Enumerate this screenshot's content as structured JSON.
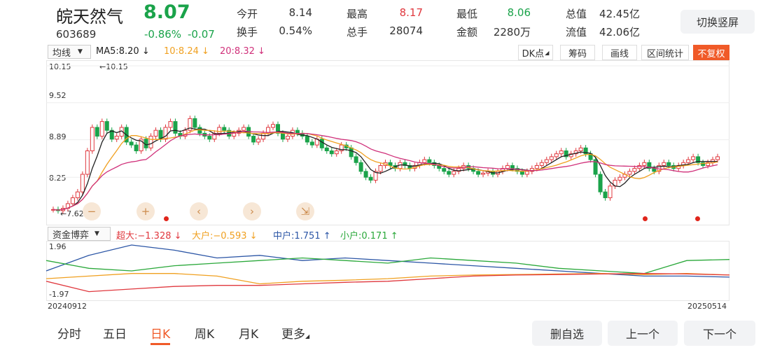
{
  "header": {
    "name": "皖天然气",
    "price": "8.07",
    "code": "603689",
    "change_pct": "-0.86%",
    "change_amt": "-0.07",
    "quotes": [
      {
        "label": "今开",
        "value": "8.14",
        "color": "#333333"
      },
      {
        "label": "最高",
        "value": "8.17",
        "color": "#e0383e"
      },
      {
        "label": "最低",
        "value": "8.06",
        "color": "#1aa34a"
      },
      {
        "label": "总值",
        "value": "42.45亿",
        "color": "#333333"
      },
      {
        "label": "换手",
        "value": "0.54%",
        "color": "#333333"
      },
      {
        "label": "总手",
        "value": "28074",
        "color": "#333333"
      },
      {
        "label": "金额",
        "value": "2280万",
        "color": "#333333"
      },
      {
        "label": "流值",
        "value": "42.06亿",
        "color": "#333333"
      }
    ],
    "orientation_button": "切换竖屏"
  },
  "toolbar": {
    "ma_select": "均线",
    "ma5": "MA5:8.20",
    "ma10": "10:8.24",
    "ma20": "20:8.32",
    "ma5_color": "#222222",
    "ma10_color": "#f0a020",
    "ma20_color": "#d0307a",
    "dk_button": "DK点",
    "chips_button": "筹码",
    "draw_button": "画线",
    "range_button": "区间统计",
    "adjust_button": "不复权"
  },
  "chart": {
    "y_labels": [
      "10.15",
      "9.52",
      "8.89",
      "8.25",
      "7.62"
    ],
    "max_label": "←10.15",
    "min_label": "←7.62",
    "start_date": "20240912",
    "end_date": "20250514"
  },
  "chart_data": {
    "type": "candlestick",
    "ylim": [
      7.62,
      10.15
    ],
    "close": [
      7.7,
      7.68,
      7.72,
      7.8,
      7.9,
      8.0,
      8.3,
      8.7,
      9.1,
      8.95,
      9.2,
      9.05,
      8.9,
      8.95,
      9.1,
      8.85,
      8.8,
      8.7,
      8.9,
      8.75,
      8.95,
      9.05,
      8.9,
      9.1,
      9.2,
      9.0,
      8.95,
      9.05,
      9.25,
      9.1,
      9.0,
      8.95,
      8.9,
      9.0,
      9.1,
      9.05,
      8.95,
      9.0,
      9.05,
      9.1,
      8.95,
      8.85,
      8.9,
      9.0,
      9.1,
      9.15,
      9.0,
      8.9,
      8.95,
      9.05,
      9.0,
      8.95,
      8.85,
      8.8,
      8.9,
      8.75,
      8.7,
      8.65,
      8.7,
      8.8,
      8.75,
      8.6,
      8.5,
      8.35,
      8.25,
      8.2,
      8.35,
      8.45,
      8.5,
      8.45,
      8.4,
      8.5,
      8.45,
      8.4,
      8.45,
      8.5,
      8.55,
      8.5,
      8.45,
      8.4,
      8.35,
      8.3,
      8.35,
      8.4,
      8.45,
      8.4,
      8.35,
      8.3,
      8.32,
      8.35,
      8.3,
      8.35,
      8.4,
      8.45,
      8.4,
      8.35,
      8.3,
      8.35,
      8.4,
      8.45,
      8.5,
      8.55,
      8.6,
      8.65,
      8.7,
      8.6,
      8.65,
      8.7,
      8.75,
      8.65,
      8.55,
      8.3,
      8.0,
      7.9,
      8.1,
      8.2,
      8.25,
      8.3,
      8.35,
      8.4,
      8.45,
      8.5,
      8.4,
      8.35,
      8.45,
      8.5,
      8.45,
      8.4,
      8.45,
      8.5,
      8.55,
      8.6,
      8.5,
      8.45,
      8.5,
      8.55,
      8.6
    ],
    "ma_series": [
      {
        "name": "MA5",
        "color": "#222222"
      },
      {
        "name": "10",
        "color": "#f0a020"
      },
      {
        "name": "20",
        "color": "#d0307a"
      }
    ]
  },
  "controls": {
    "zoom_out": "−",
    "zoom_in": "+",
    "prev": "‹",
    "next": "›",
    "collapse": "⇲"
  },
  "fund_flow": {
    "select": "资金博弈",
    "super": "超大:−1.328",
    "large": "大户:−0.593",
    "medium": "中户:1.751",
    "small": "小户:0.171",
    "y_top": "1.96",
    "y_bottom": "-1.97",
    "colors": {
      "super": "#e0383e",
      "large": "#f0a020",
      "medium": "#2c56a6",
      "small": "#2aa83a"
    }
  },
  "tabs": [
    "分时",
    "五日",
    "日K",
    "周K",
    "月K",
    "更多"
  ],
  "buttons": {
    "remove_fav": "删自选",
    "prev_stock": "上一个",
    "next_stock": "下一个"
  }
}
